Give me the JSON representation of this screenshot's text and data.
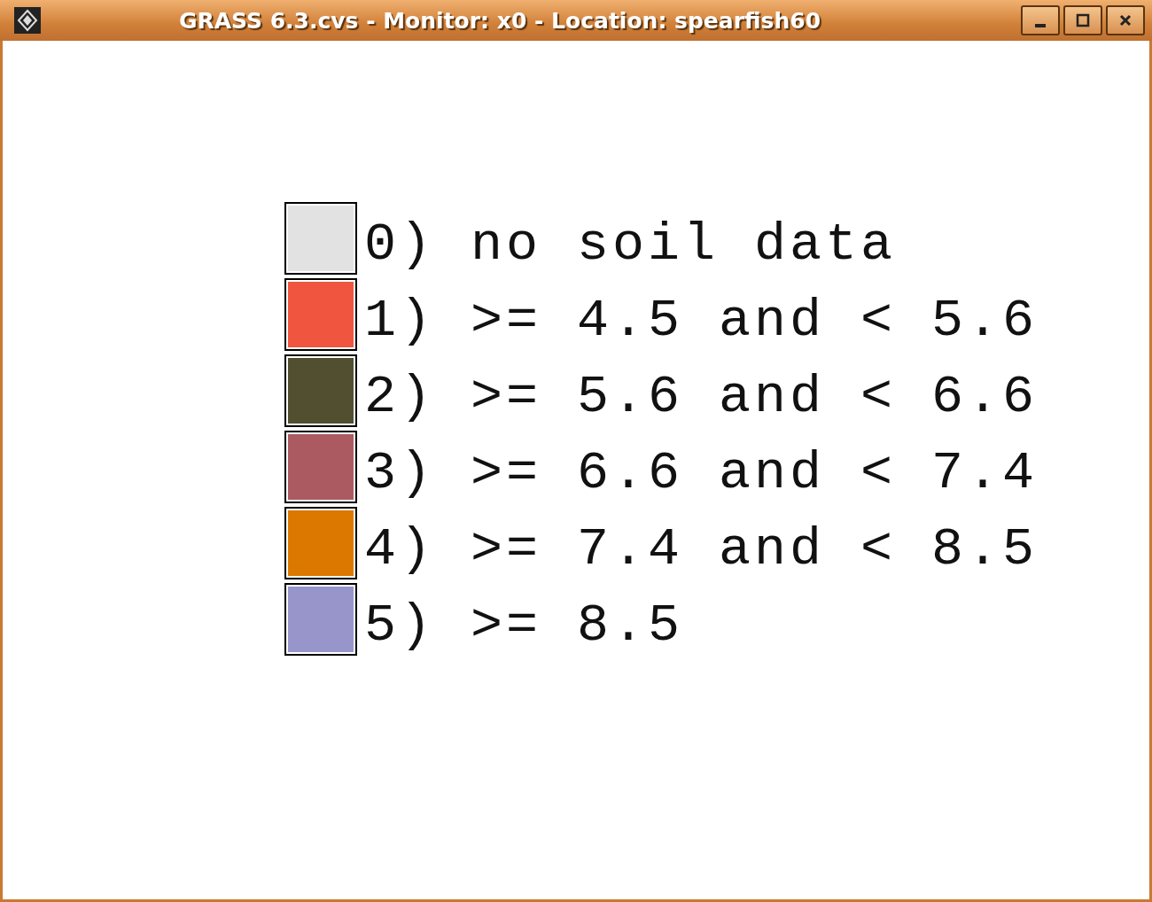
{
  "window": {
    "title": "GRASS 6.3.cvs - Monitor: x0 - Location: spearfish60"
  },
  "legend": [
    {
      "label": "0) no soil data",
      "color": "#e2e2e2"
    },
    {
      "label": "1) >= 4.5 and < 5.6",
      "color": "#f05540"
    },
    {
      "label": "2) >= 5.6 and < 6.6",
      "color": "#524e30"
    },
    {
      "label": "3) >= 6.6 and < 7.4",
      "color": "#ab5a62"
    },
    {
      "label": "4) >= 7.4 and < 8.5",
      "color": "#dc7800"
    },
    {
      "label": "5) >= 8.5",
      "color": "#9895cb"
    }
  ]
}
